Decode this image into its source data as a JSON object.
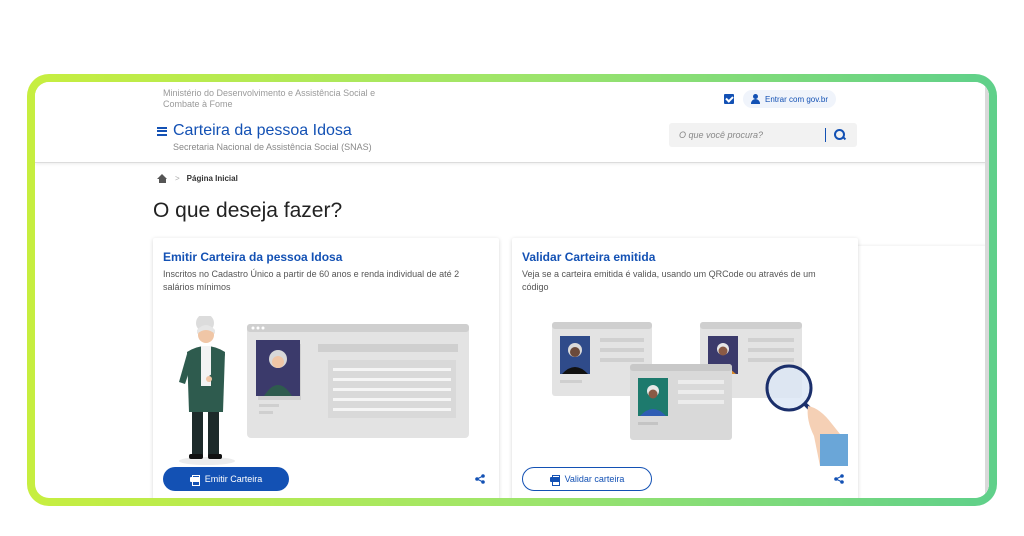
{
  "header": {
    "ministry": "Ministério do Desenvolvimento e Assistência Social e Combate à Fome",
    "site_title": "Carteira da pessoa Idosa",
    "site_subtitle": "Secretaria Nacional de Assistência Social (SNAS)",
    "login_label": "Entrar com gov.br",
    "search_placeholder": "O que você procura?"
  },
  "breadcrumb": {
    "separator": ">",
    "current": "Página Inicial"
  },
  "main": {
    "title": "O que deseja fazer?",
    "cards": [
      {
        "title": "Emitir Carteira da pessoa Idosa",
        "description": "Inscritos no Cadastro Único a partir de 60 anos e renda individual de até 2 salários mínimos",
        "button_label": "Emitir Carteira"
      },
      {
        "title": "Validar Carteira emitida",
        "description": "Veja se a carteira emitida é valida, usando um QRCode ou através de um código",
        "button_label": "Validar carteira"
      }
    ]
  },
  "colors": {
    "primary": "#1351b4",
    "frame_start": "#c7ee3f",
    "frame_end": "#5fd08a"
  }
}
